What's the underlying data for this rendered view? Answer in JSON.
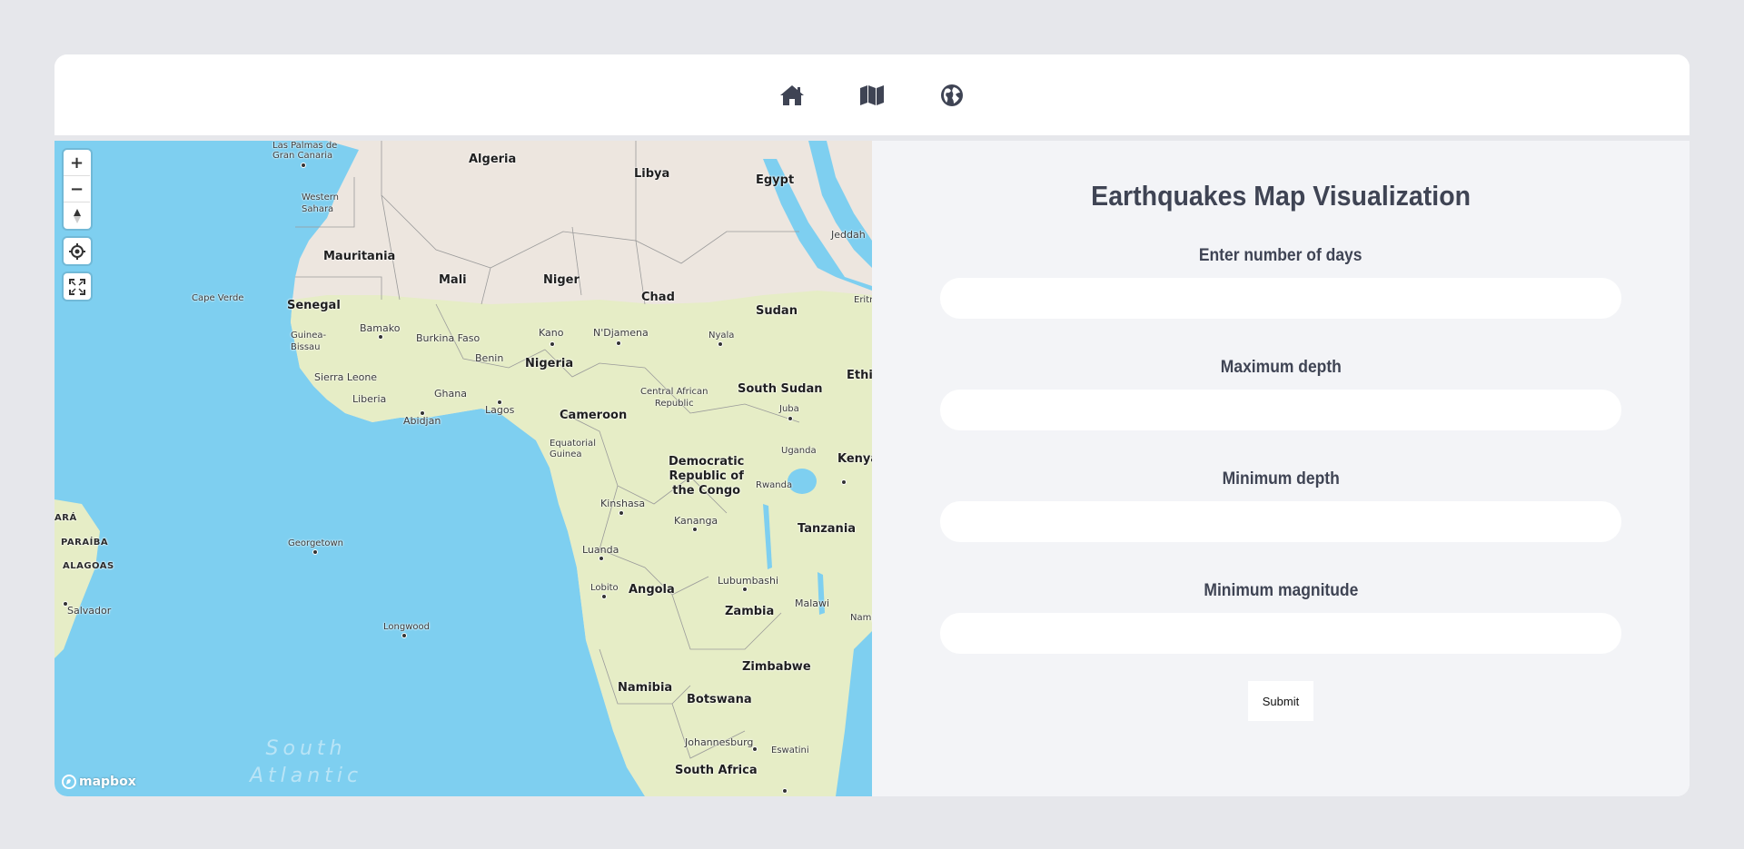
{
  "nav": {
    "items": [
      {
        "icon": "home-icon"
      },
      {
        "icon": "map-icon"
      },
      {
        "icon": "globe-icon"
      }
    ]
  },
  "map": {
    "controls": {
      "zoom_in": "+",
      "zoom_out": "−"
    },
    "attribution": "mapbox",
    "countries": [
      "Algeria",
      "Libya",
      "Egypt",
      "Western Sahara",
      "Mauritania",
      "Mali",
      "Niger",
      "Chad",
      "Sudan",
      "Senegal",
      "Guinea-Bissau",
      "Burkina Faso",
      "Benin",
      "Nigeria",
      "Sierra Leone",
      "Liberia",
      "Ghana",
      "Central African Republic",
      "South Sudan",
      "Cameroon",
      "Equatorial Guinea",
      "Democratic Republic of the Congo",
      "Uganda",
      "Kenya",
      "Rwanda",
      "Tanzania",
      "Angola",
      "Zambia",
      "Malawi",
      "Namibia",
      "Zimbabwe",
      "Botswana",
      "South Africa",
      "Eswatini",
      "Ethi",
      "Eritre",
      "Namp"
    ],
    "cities": [
      "Las Palmas de Gran Canaria",
      "Jeddah",
      "Cape Verde",
      "Bamako",
      "Kano",
      "N'Djamena",
      "Nyala",
      "Abidjan",
      "Lagos",
      "Juba",
      "Kinshasa",
      "Kananga",
      "Luanda",
      "Lobito",
      "Lubumbashi",
      "Georgetown",
      "Longwood",
      "Johannesburg",
      "Salvador"
    ],
    "regions": [
      "PARÁ",
      "PARAÍBA",
      "ALAGOAS"
    ],
    "ocean": "South Atlantic"
  },
  "form": {
    "title": "Earthquakes Map Visualization",
    "fields": [
      {
        "label": "Enter number of days",
        "value": ""
      },
      {
        "label": "Maximum depth",
        "value": ""
      },
      {
        "label": "Minimum depth",
        "value": ""
      },
      {
        "label": "Minimum magnitude",
        "value": ""
      }
    ],
    "submit_label": "Submit"
  },
  "colors": {
    "page_bg": "#e6e7eb",
    "form_bg": "#f3f4f7",
    "text_dark": "#3f4454",
    "ocean": "#7ecff0",
    "land_desert": "#ede6df",
    "land_green": "#e6edc6"
  }
}
